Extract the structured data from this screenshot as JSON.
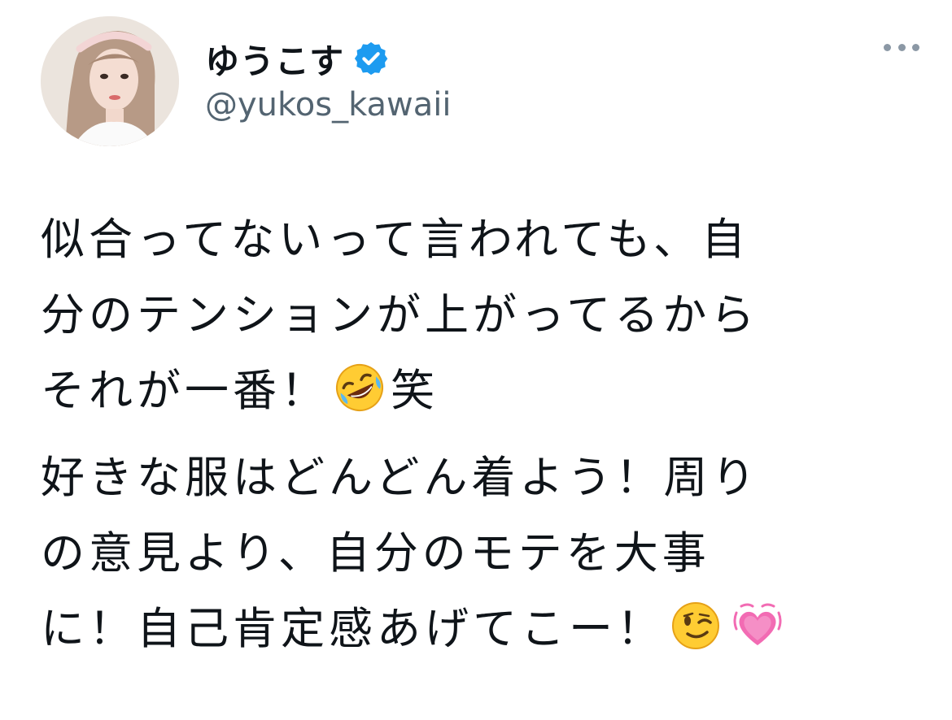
{
  "tweet": {
    "author": {
      "display_name": "ゆうこす",
      "handle": "@yukos_kawaii",
      "verified": true,
      "avatar_icon": "avatar-photo"
    },
    "more_icon": "more-horizontal-icon",
    "paragraphs": [
      {
        "lines": [
          [
            "似合ってないって言われても、自"
          ],
          [
            "分のテンションが上がってるから"
          ],
          [
            "それが一番！",
            "rolling-on-floor-laughing-emoji",
            "笑"
          ]
        ]
      },
      {
        "lines": [
          [
            "好きな服はどんどん着よう！周り"
          ],
          [
            "の意見より、自分のモテを大事"
          ],
          [
            "に！自己肯定感あげてこー！",
            "winking-face-emoji",
            "growing-heart-emoji"
          ]
        ]
      }
    ]
  },
  "colors": {
    "text": "#0f1419",
    "secondary": "#536471",
    "verified": "#1d9bf0",
    "heart": "#f26bb3"
  }
}
